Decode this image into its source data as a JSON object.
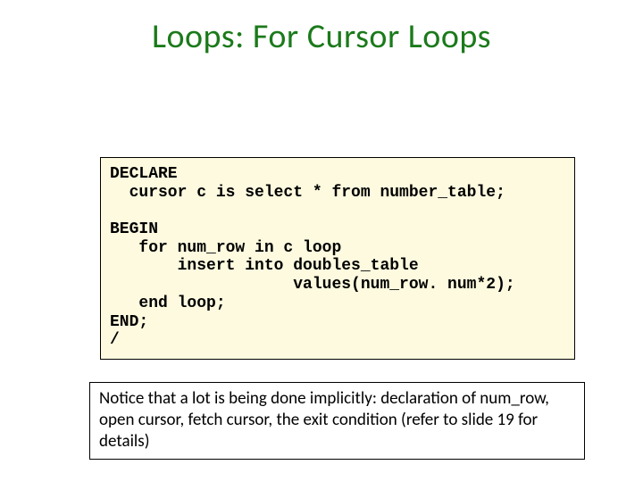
{
  "title": "Loops: For Cursor Loops",
  "code": "DECLARE\n  cursor c is select * from number_table;\n \nBEGIN\n   for num_row in c loop\n       insert into doubles_table\n                   values(num_row. num*2);\n   end loop;\nEND;\n/",
  "note": "Notice that a lot is being done implicitly: declaration of num_row, open cursor, fetch cursor, the exit condition  (refer to slide 19 for details)"
}
